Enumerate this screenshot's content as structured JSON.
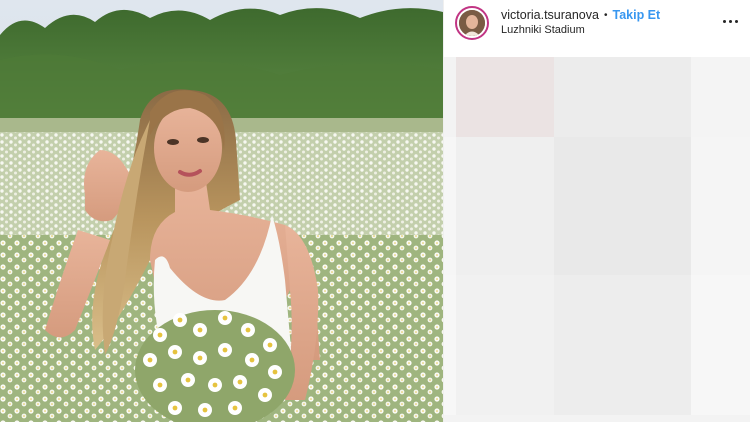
{
  "header": {
    "username": "victoria.tsuranova",
    "separator": "•",
    "follow_label": "Takip Et",
    "location": "Luzhniki Stadium"
  },
  "icons": {
    "more": "more-options-icon",
    "avatar": "profile-avatar"
  },
  "colors": {
    "follow": "#3897f0",
    "story_ring": "#c13584",
    "text": "#262626"
  }
}
